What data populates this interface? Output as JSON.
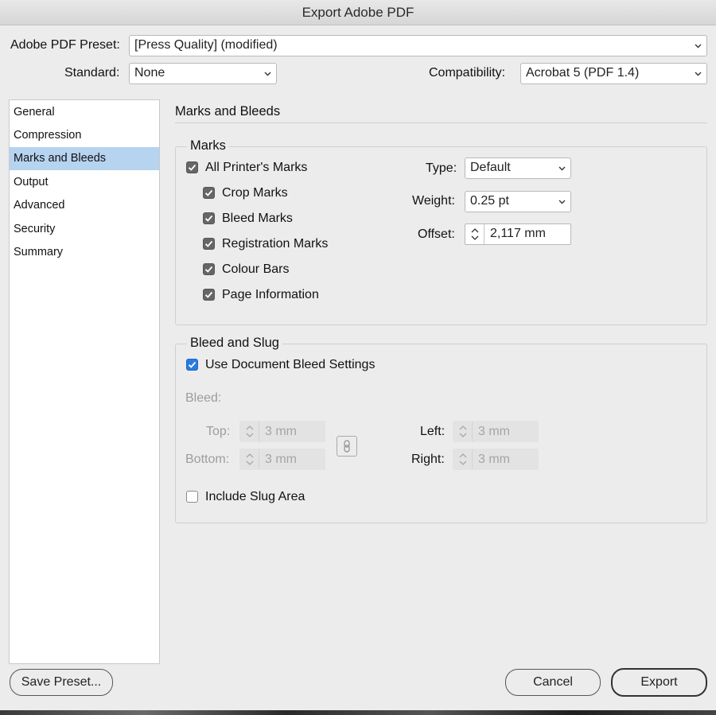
{
  "window": {
    "title": "Export Adobe PDF"
  },
  "preset": {
    "label": "Adobe PDF Preset:",
    "value": "[Press Quality] (modified)"
  },
  "standard": {
    "label": "Standard:",
    "value": "None"
  },
  "compatibility": {
    "label": "Compatibility:",
    "value": "Acrobat 5 (PDF 1.4)"
  },
  "sidebar": {
    "items": [
      {
        "label": "General"
      },
      {
        "label": "Compression"
      },
      {
        "label": "Marks and Bleeds"
      },
      {
        "label": "Output"
      },
      {
        "label": "Advanced"
      },
      {
        "label": "Security"
      },
      {
        "label": "Summary"
      }
    ],
    "selected_index": 2
  },
  "panel": {
    "title": "Marks and Bleeds"
  },
  "marks": {
    "legend": "Marks",
    "all": {
      "label": "All Printer's Marks",
      "checked": true
    },
    "items": [
      {
        "label": "Crop Marks",
        "checked": true
      },
      {
        "label": "Bleed Marks",
        "checked": true
      },
      {
        "label": "Registration Marks",
        "checked": true
      },
      {
        "label": "Colour Bars",
        "checked": true
      },
      {
        "label": "Page Information",
        "checked": true
      }
    ],
    "type": {
      "label": "Type:",
      "value": "Default"
    },
    "weight": {
      "label": "Weight:",
      "value": "0.25 pt"
    },
    "offset": {
      "label": "Offset:",
      "value": "2,117 mm"
    }
  },
  "bleed": {
    "legend": "Bleed and Slug",
    "use_doc": {
      "label": "Use Document Bleed Settings",
      "checked": true
    },
    "bleed_label": "Bleed:",
    "top": {
      "label": "Top:",
      "value": "3 mm"
    },
    "bottom": {
      "label": "Bottom:",
      "value": "3 mm"
    },
    "left": {
      "label": "Left:",
      "value": "3 mm"
    },
    "right": {
      "label": "Right:",
      "value": "3 mm"
    },
    "slug": {
      "label": "Include Slug Area",
      "checked": false
    }
  },
  "buttons": {
    "save_preset": "Save Preset...",
    "cancel": "Cancel",
    "export": "Export"
  },
  "colors": {
    "selection": "#b6d3f0",
    "checkbox_blue": "#2b7be0",
    "checkbox_gray": "#666666"
  }
}
